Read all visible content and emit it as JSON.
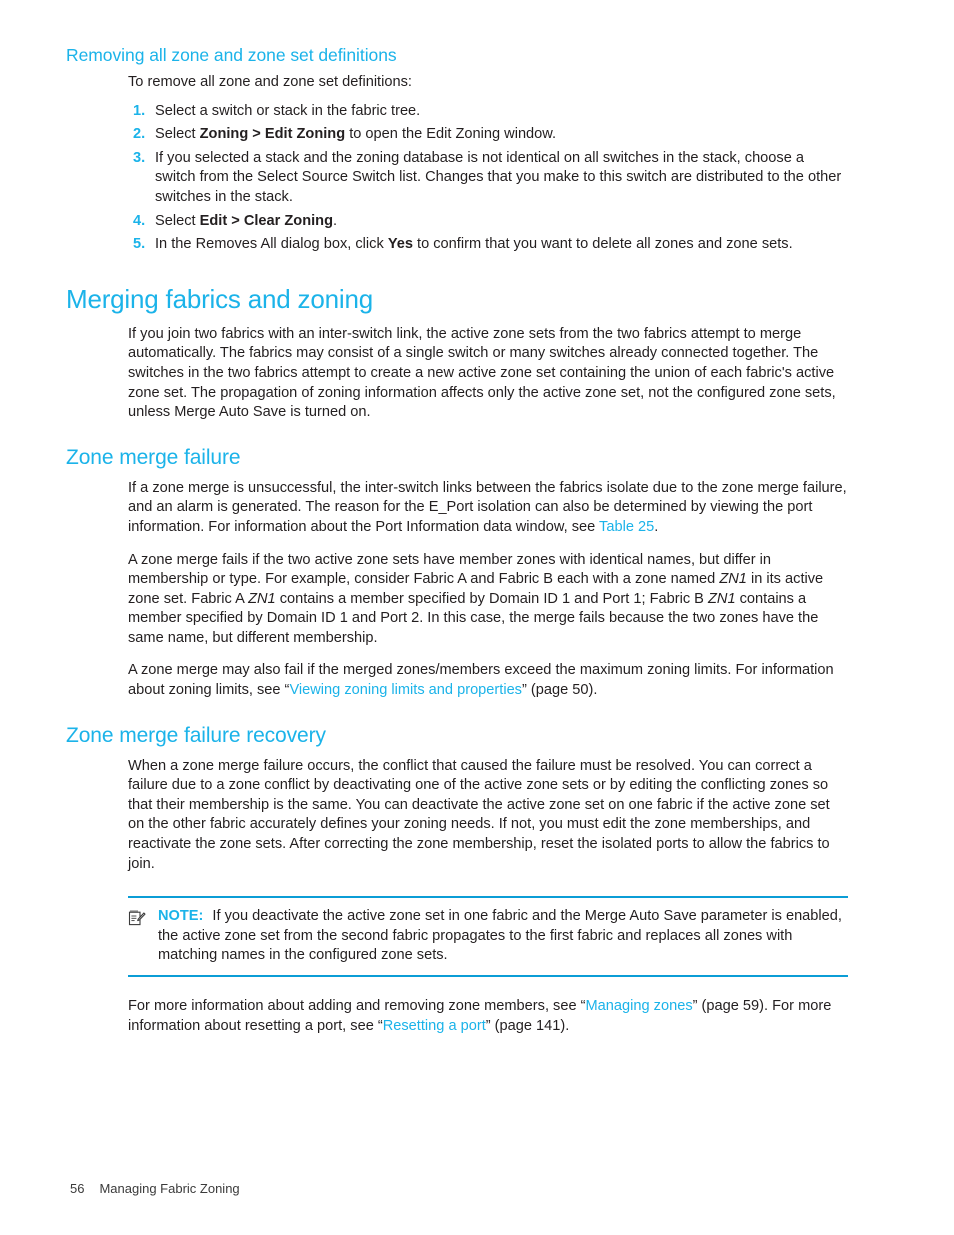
{
  "page": {
    "number": "56",
    "running_title": "Managing Fabric Zoning",
    "accent_color": "#1bb3e9",
    "rule_color": "#0b9dd6",
    "text_color": "#231f20"
  },
  "section_removing": {
    "heading": "Removing all zone and zone set definitions",
    "intro": "To remove all zone and zone set definitions:",
    "steps": [
      {
        "num": "1.",
        "text_before": "Select a switch or stack in the fabric tree.",
        "bold": "",
        "text_after": ""
      },
      {
        "num": "2.",
        "text_before": "Select ",
        "bold": "Zoning > Edit Zoning",
        "text_after": " to open the Edit Zoning window."
      },
      {
        "num": "3.",
        "text_before": "If you selected a stack and the zoning database is not identical on all switches in the stack, choose a switch from the Select Source Switch list. Changes that you make to this switch are distributed to the other switches in the stack.",
        "bold": "",
        "text_after": ""
      },
      {
        "num": "4.",
        "text_before": "Select ",
        "bold": "Edit > Clear Zoning",
        "text_after": "."
      },
      {
        "num": "5.",
        "text_before": "In the Removes All dialog box, click ",
        "bold": "Yes",
        "text_after": " to confirm that you want to delete all zones and zone sets."
      }
    ]
  },
  "section_merging": {
    "heading": "Merging fabrics and zoning",
    "paragraph": "If you join two fabrics with an inter-switch link, the active zone sets from the two fabrics attempt to merge automatically. The fabrics may consist of a single switch or many switches already connected together. The switches in the two fabrics attempt to create a new active zone set containing the union of each fabric's active zone set. The propagation of zoning information affects only the active zone set, not the configured zone sets, unless Merge Auto Save is turned on."
  },
  "section_zone_merge_failure": {
    "heading": "Zone merge failure",
    "p1_a": "If a zone merge is unsuccessful, the inter-switch links between the fabrics isolate due to the zone merge failure, and an alarm is generated. The reason for the E_Port isolation can also be determined by viewing the port information. For information about the Port Information data window, see ",
    "p1_link": "Table 25",
    "p1_b": ".",
    "p2_a": "A zone merge fails if the two active zone sets have member zones with identical names, but differ in membership or type. For example, consider Fabric A and Fabric B each with a zone named ",
    "p2_i1": "ZN1",
    "p2_b": " in its active zone set. Fabric A ",
    "p2_i2": "ZN1",
    "p2_c": " contains a member specified by Domain ID 1 and Port 1; Fabric B ",
    "p2_i3": "ZN1",
    "p2_d": " contains a member specified by Domain ID 1 and Port 2. In this case, the merge fails because the two zones have the same name, but different membership.",
    "p3_a": "A zone merge may also fail if the merged zones/members exceed the maximum zoning limits. For information about zoning limits, see “",
    "p3_link": "Viewing zoning limits and properties",
    "p3_b": "” (page 50)."
  },
  "section_recovery": {
    "heading": "Zone merge failure recovery",
    "paragraph": "When a zone merge failure occurs, the conflict that caused the failure must be resolved. You can correct a failure due to a zone conflict by deactivating one of the active zone sets or by editing the conflicting zones so that their membership is the same. You can deactivate the active zone set on one fabric if the active zone set on the other fabric accurately defines your zoning needs. If not, you must edit the zone memberships, and reactivate the zone sets. After correcting the zone membership, reset the isolated ports to allow the fabrics to join."
  },
  "note": {
    "icon": "note-pad-pencil-icon",
    "label": "NOTE:",
    "text": "If you deactivate the active zone set in one fabric and the Merge Auto Save parameter is enabled, the active zone set from the second fabric propagates to the first fabric and replaces all zones with matching names in the configured zone sets."
  },
  "closing": {
    "a": "For more information about adding and removing zone members, see “",
    "link1": "Managing zones",
    "b": "” (page 59). For more information about resetting a port, see “",
    "link2": "Resetting a port",
    "c": "” (page 141)."
  }
}
